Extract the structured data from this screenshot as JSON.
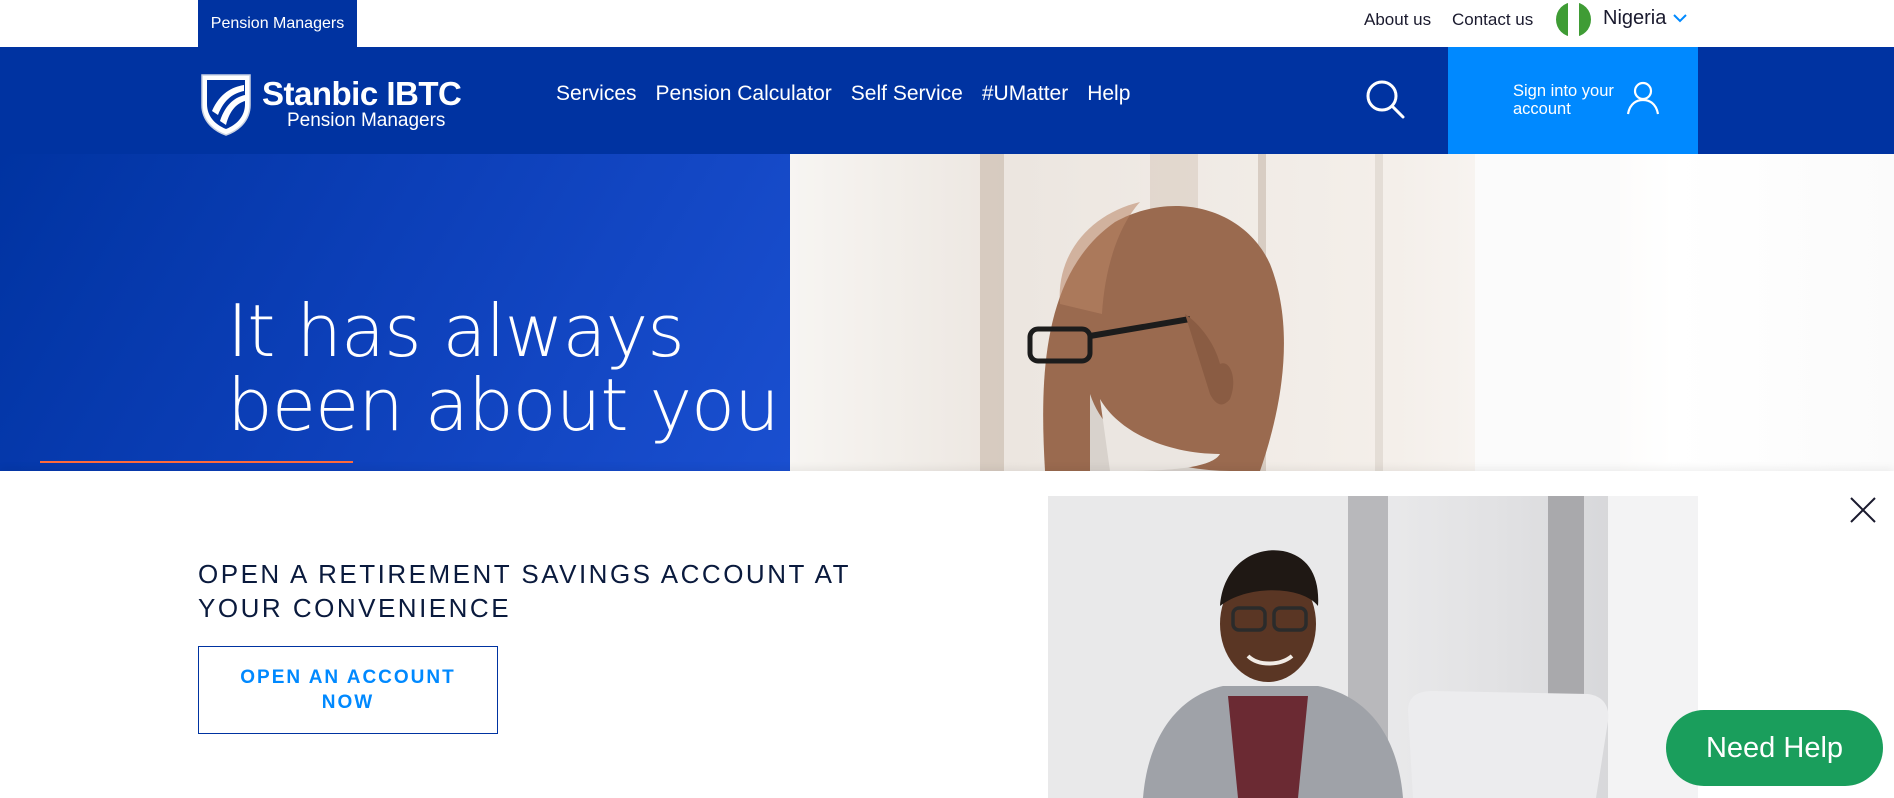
{
  "topbar": {
    "tab_label": "Pension Managers",
    "about_label": "About us",
    "contact_label": "Contact us",
    "country": "Nigeria",
    "flag_colors": [
      "#3f9c35",
      "#ffffff",
      "#3f9c35"
    ]
  },
  "nav": {
    "brand_name": "Stanbic IBTC",
    "brand_sub": "Pension Managers",
    "items": [
      {
        "label": "Services"
      },
      {
        "label": "Pension Calculator"
      },
      {
        "label": "Self Service"
      },
      {
        "label": "#UMatter"
      },
      {
        "label": "Help"
      }
    ],
    "search_icon": "search-icon",
    "signin_label": "Sign into your account",
    "signin_icon": "user-icon"
  },
  "hero": {
    "title_line1": "It has always",
    "title_line2": "been about you"
  },
  "popup": {
    "headline": "OPEN A RETIREMENT SAVINGS ACCOUNT AT YOUR CONVENIENCE",
    "cta_label": "OPEN AN ACCOUNT NOW",
    "close_icon": "close-icon"
  },
  "need_help": {
    "label": "Need Help"
  },
  "colors": {
    "brand_blue": "#0033a1",
    "accent_blue": "#0089ff",
    "help_green": "#1a9e5c",
    "hero_accent_line": "#ff6a3c"
  }
}
